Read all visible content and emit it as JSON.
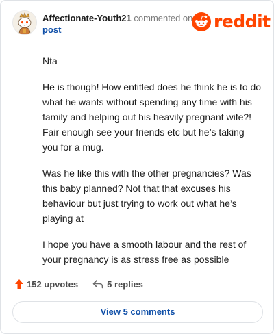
{
  "header": {
    "username": "Affectionate-Youth21",
    "action": "commented on",
    "post_link": "post",
    "logo_text": "reddit",
    "brand_color": "#ff4500",
    "link_color": "#0f4fa8",
    "avatar_icon": "snoo-avatar-icon",
    "logo_icon": "reddit-alien-icon"
  },
  "comment": {
    "paragraphs": [
      "Nta",
      "He is though! How entitled does he think he is to do what he wants without spending any time with his family and helping out his heavily pregnant wife?! Fair enough see your friends etc but he’s taking you for a mug.",
      "Was he like this with the other pregnancies? Was this baby planned? Not that that excuses his behaviour but just trying to work out what he’s playing at",
      "I hope you have a smooth labour and the rest of your pregnancy is as stress free as possible"
    ]
  },
  "footer": {
    "upvotes": "152 upvotes",
    "replies": "5 replies",
    "upvote_icon": "upvote-arrow-icon",
    "reply_icon": "reply-arrow-icon"
  },
  "actions": {
    "view_comments": "View 5 comments"
  }
}
